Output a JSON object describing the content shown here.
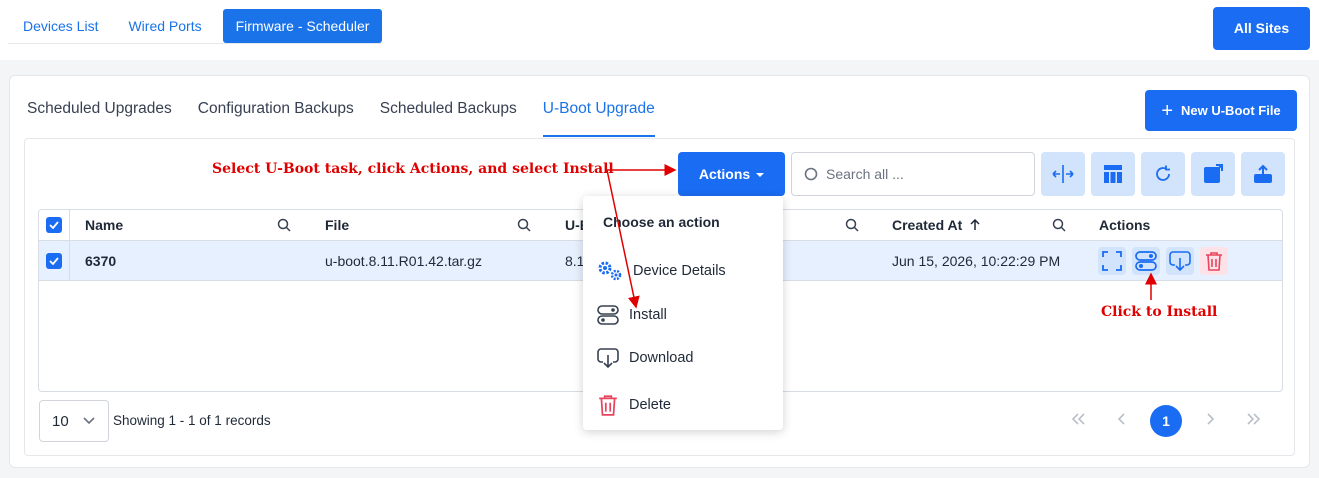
{
  "top_tabs": [
    {
      "label": "Devices List"
    },
    {
      "label": "Wired Ports"
    },
    {
      "label": "Firmware - Scheduler"
    }
  ],
  "all_sites_label": "All Sites",
  "sub_tabs": [
    {
      "label": "Scheduled Upgrades"
    },
    {
      "label": "Configuration Backups"
    },
    {
      "label": "Scheduled Backups"
    },
    {
      "label": "U-Boot Upgrade"
    }
  ],
  "new_uboot_label": "New U-Boot File",
  "toolbar": {
    "actions_label": "Actions",
    "search_placeholder": "Search all ..."
  },
  "table": {
    "columns": [
      "Name",
      "File",
      "U-B",
      "Created At",
      "Actions"
    ],
    "rows": [
      {
        "name": "6370",
        "file": "u-boot.8.11.R01.42.tar.gz",
        "version": "8.1",
        "created_at": "Jun 15, 2026, 10:22:29 PM"
      }
    ]
  },
  "footer": {
    "page_size": "10",
    "showing": "Showing 1 - 1 of 1 records",
    "current_page": "1"
  },
  "dropdown": {
    "title": "Choose an action",
    "items": [
      {
        "label": "Device Details",
        "icon": "gears-icon"
      },
      {
        "label": "Install",
        "icon": "toggle-install-icon"
      },
      {
        "label": "Download",
        "icon": "download-icon"
      },
      {
        "label": "Delete",
        "icon": "trash-icon"
      }
    ]
  },
  "annotations": {
    "instruction": "Select U-Boot task, click Actions, and select Install",
    "click_install": "Click to Install"
  },
  "colors": {
    "primary": "#1a6cf2",
    "icon_bg": "#d2e3fc",
    "row_highlight": "#e7f0fe",
    "delete": "#e8455f",
    "annotation": "#e00000"
  }
}
